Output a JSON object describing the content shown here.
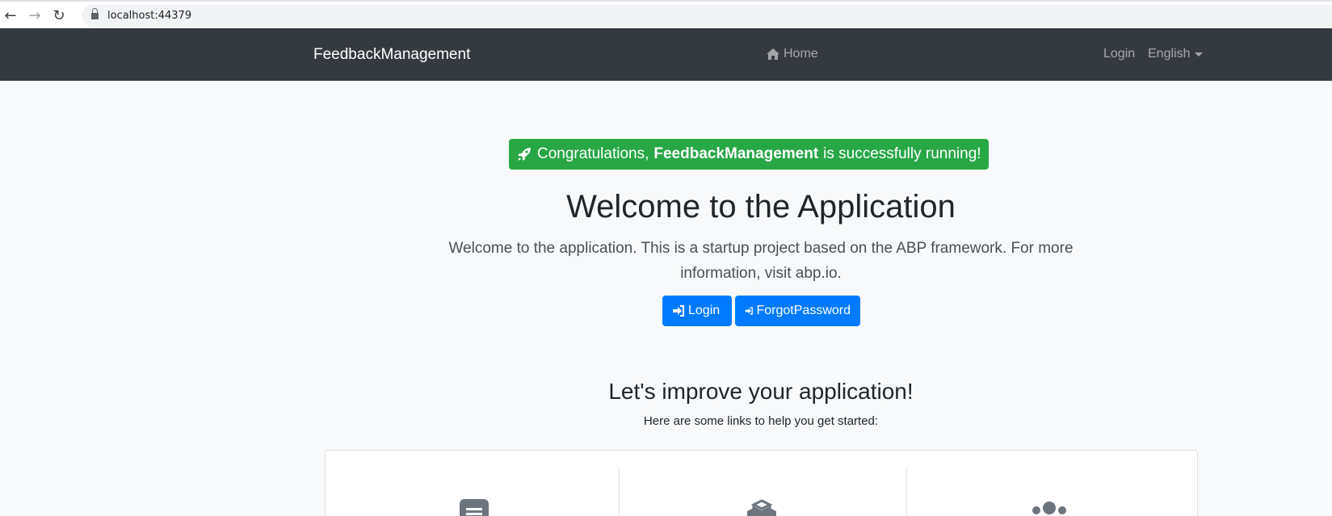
{
  "browser": {
    "url": "localhost:44379"
  },
  "navbar": {
    "brand": "FeedbackManagement",
    "home_label": "Home",
    "login_label": "Login",
    "language_label": "English"
  },
  "hero": {
    "badge_prefix": "Congratulations,",
    "badge_app_name": "FeedbackManagement",
    "badge_suffix": "is successfully running!",
    "title": "Welcome to the Application",
    "text": "Welcome to the application. This is a startup project based on the ABP framework. For more information, visit abp.io.",
    "login_button": "Login",
    "forgot_button": "ForgotPassword"
  },
  "improve": {
    "title": "Let's improve your application!",
    "subtitle": "Here are some links to help you get started:"
  },
  "cards": [
    {
      "icon": "document-icon"
    },
    {
      "icon": "cube-icon"
    },
    {
      "icon": "users-icon"
    }
  ],
  "colors": {
    "navbar_bg": "#343a40",
    "success": "#28a745",
    "primary": "#007bff",
    "page_bg": "#f8f9fa"
  }
}
